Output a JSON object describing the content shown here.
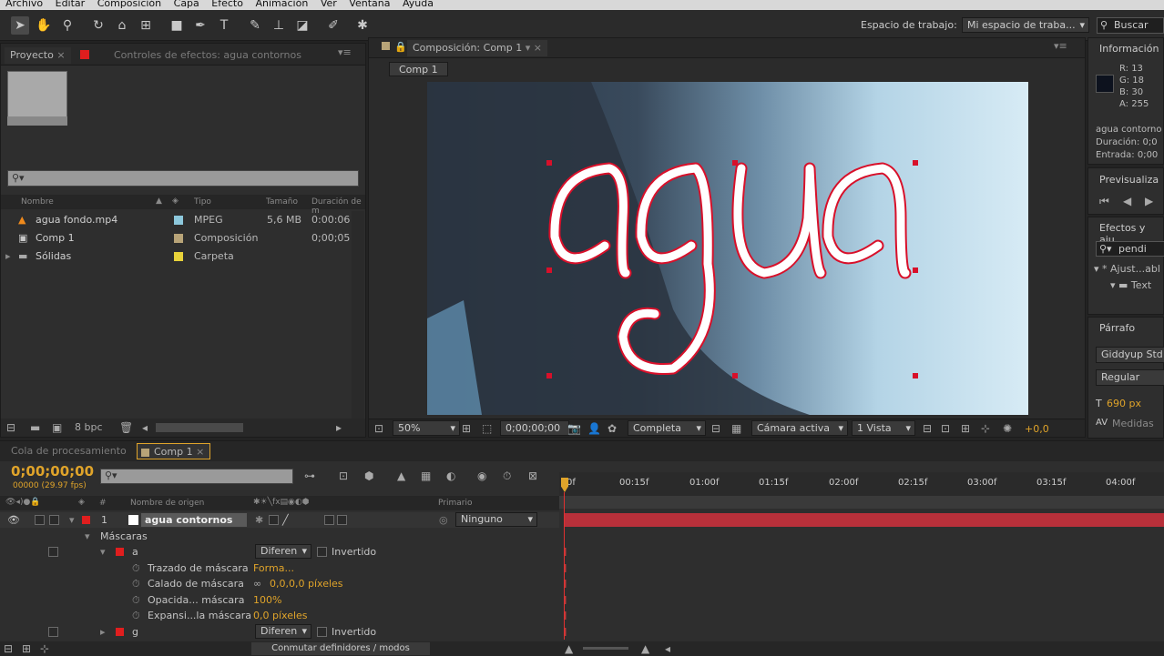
{
  "menu": [
    "Archivo",
    "Editar",
    "Composición",
    "Capa",
    "Efecto",
    "Animación",
    "Ver",
    "Ventana",
    "Ayuda"
  ],
  "toolbar": {
    "workspace_label": "Espacio de trabajo:",
    "workspace_value": "Mi espacio de traba...",
    "search_placeholder": "Buscar en"
  },
  "project": {
    "tab_project": "Proyecto",
    "tab_effects": "Controles de efectos: agua contornos",
    "search_placeholder": "",
    "columns": {
      "name": "Nombre",
      "type": "Tipo",
      "size": "Tamaño",
      "duration": "Duración de m"
    },
    "items": [
      {
        "name": "agua fondo.mp4",
        "type": "MPEG",
        "size": "5,6 MB",
        "duration": "0:00:06",
        "color": "#8dc8dc"
      },
      {
        "name": "Comp 1",
        "type": "Composición",
        "size": "",
        "duration": "0;00;05",
        "color": "#b8a478"
      },
      {
        "name": "Sólidas",
        "type": "Carpeta",
        "size": "",
        "duration": "",
        "color": "#e8d23a"
      }
    ],
    "bpc": "8 bpc"
  },
  "composition": {
    "tab": "Composición: Comp 1",
    "breadcrumb": "Comp 1",
    "text": "agua",
    "zoom": "50%",
    "timecode": "0;00;00;00",
    "quality": "Completa",
    "camera": "Cámara activa",
    "views": "1 Vista",
    "offset": "+0,0"
  },
  "info": {
    "title": "Información",
    "r": "R:  13",
    "g": "G:  18",
    "b": "B:  30",
    "a": "A:  255",
    "swatch": "#0d121e",
    "layer": "agua contorno",
    "duration": "Duración: 0;0",
    "entry": "Entrada: 0;00"
  },
  "preview": {
    "title": "Previsualiza"
  },
  "effects": {
    "title": "Efectos y aju",
    "search": "pendi",
    "item1": "* Ajust...abl",
    "item2": "Text"
  },
  "paragraph": {
    "title": "Párrafo",
    "font": "Giddyup Std",
    "style": "Regular",
    "size": "690 px",
    "metrics": "Medidas"
  },
  "timeline": {
    "tab_render": "Cola de procesamiento",
    "tab_comp": "Comp 1",
    "timecode": "0;00;00;00",
    "fps": "00000 (29.97 fps)",
    "col_name": "Nombre de origen",
    "col_parent": "Primario",
    "col_num": "#",
    "ruler": [
      "0f",
      "00:15f",
      "01:00f",
      "01:15f",
      "02:00f",
      "02:15f",
      "03:00f",
      "03:15f",
      "04:00f"
    ],
    "layer": {
      "num": "1",
      "name": "agua contornos",
      "parent": "Ninguno"
    },
    "masks_label": "Máscaras",
    "mask_a": {
      "name": "a",
      "mode": "Diferen",
      "inverted": "Invertido"
    },
    "props": [
      {
        "name": "Trazado de máscara",
        "value": "Forma..."
      },
      {
        "name": "Calado de máscara",
        "value": "0,0,0,0  píxeles"
      },
      {
        "name": "Opacida... máscara",
        "value": "100%"
      },
      {
        "name": "Expansi...la máscara",
        "value": "0,0  píxeles"
      }
    ],
    "mask_g": {
      "name": "g",
      "mode": "Diferen",
      "inverted": "Invertido"
    },
    "toggle_label": "Conmutar definidores / modos"
  }
}
